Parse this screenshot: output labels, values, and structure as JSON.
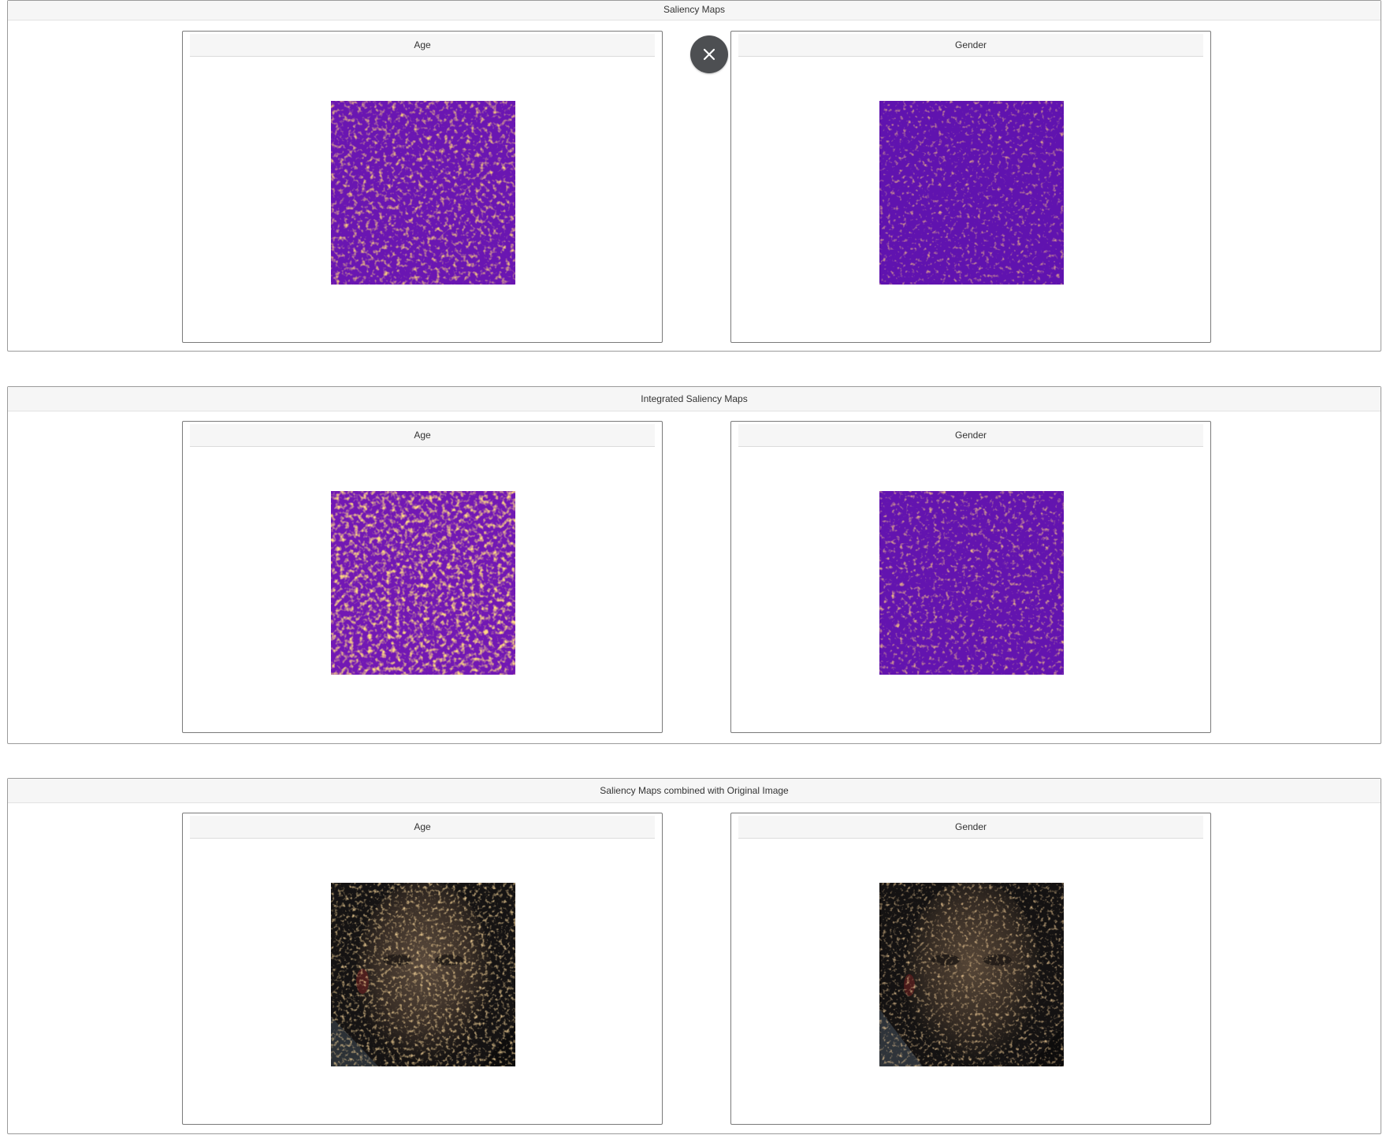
{
  "sections": [
    {
      "title": "Saliency Maps",
      "cards": [
        {
          "label": "Age",
          "image": "age-saliency-map"
        },
        {
          "label": "Gender",
          "image": "gender-saliency-map"
        }
      ]
    },
    {
      "title": "Integrated Saliency Maps",
      "cards": [
        {
          "label": "Age",
          "image": "age-integrated-saliency-map"
        },
        {
          "label": "Gender",
          "image": "gender-integrated-saliency-map"
        }
      ]
    },
    {
      "title": "Saliency Maps combined with Original Image",
      "cards": [
        {
          "label": "Age",
          "image": "age-saliency-overlay-face"
        },
        {
          "label": "Gender",
          "image": "gender-saliency-overlay-face"
        }
      ]
    }
  ],
  "close_button": {
    "icon": "close-icon"
  },
  "colors": {
    "heatmap_base": "#5a12b0",
    "heatmap_hot": "#f3b23a",
    "overlay_base": "#1f1a17",
    "close_button_bg": "#4d4f52"
  }
}
